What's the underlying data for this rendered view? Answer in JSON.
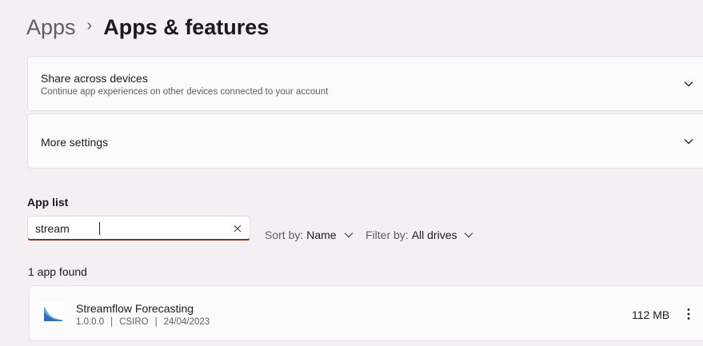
{
  "breadcrumb": {
    "parent": "Apps",
    "separator": "›",
    "current": "Apps & features"
  },
  "cards": {
    "share": {
      "title": "Share across devices",
      "description": "Continue app experiences on other devices connected to your account",
      "icon": "chevron-down-icon"
    },
    "more": {
      "title": "More settings",
      "icon": "chevron-down-icon"
    }
  },
  "app_list": {
    "label": "App list",
    "search": {
      "value": "stream",
      "clear_icon": "close-icon"
    },
    "sort": {
      "label": "Sort by:",
      "value": "Name"
    },
    "filter": {
      "label": "Filter by:",
      "value": "All drives"
    },
    "count_text": "1 app found",
    "apps": [
      {
        "name": "Streamflow Forecasting",
        "version": "1.0.0.0",
        "publisher": "CSIRO",
        "date": "24/04/2023",
        "size": "112 MB",
        "icon": "streamflow-app-icon"
      }
    ]
  },
  "colors": {
    "background": "#f3eff3",
    "card": "#fbfbfb",
    "accent_underline": "#8e2d1e"
  }
}
